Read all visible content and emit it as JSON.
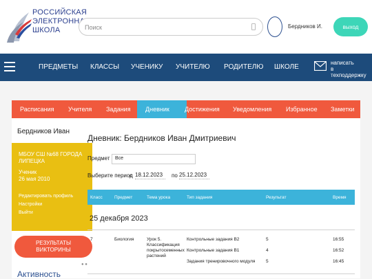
{
  "header": {
    "logo_lines": [
      "РОССИЙСКАЯ",
      "ЭЛЕКТРОННАЯ",
      "ШКОЛА"
    ],
    "search_placeholder": "Поиск",
    "user_name": "Бердников И.",
    "logout_label": "выход"
  },
  "nav": {
    "items": [
      "ПРЕДМЕТЫ",
      "КЛАССЫ",
      "УЧЕНИКУ",
      "УЧИТЕЛЮ",
      "РОДИТЕЛЮ",
      "ШКОЛЕ"
    ],
    "support_lines": [
      "написать",
      "в техподдержку"
    ]
  },
  "tabs": [
    "Расписания",
    "Учителя",
    "Задания",
    "Дневник",
    "Достижения",
    "Уведомления",
    "Избранное",
    "Заметки"
  ],
  "active_tab": "Дневник",
  "sidebar": {
    "name": "Бердников Иван",
    "school_lines": [
      "МБОУ СШ №68 ГОРОДА",
      "ЛИПЕЦКА"
    ],
    "role": "Ученик",
    "dob": "26 мая 2010",
    "links": [
      "Редактировать профиль",
      "Настройки",
      "Выйти"
    ],
    "quiz_lines": [
      "РЕЗУЛЬТАТЫ",
      "ВИКТОРИНЫ"
    ],
    "activity_label": "Активность"
  },
  "diary": {
    "title": "Дневник: Бердников Иван Дмитриевич",
    "subject_label": "Предмет",
    "subject_value": "Все",
    "period_label": "Выберите период",
    "from_label": "с",
    "from_value": "18.12.2023",
    "to_label": "по",
    "to_value": "25.12.2023",
    "columns": [
      "Класс",
      "Предмет",
      "Тема урока",
      "Тип задания",
      "Результат",
      "Время"
    ],
    "date_heading": "25 декабря 2023",
    "row": {
      "class": "7",
      "subject": "Биология",
      "topic_lines": [
        "Урок 5.",
        "Классификация",
        "покрытосеменных",
        "растений"
      ],
      "tasks": [
        {
          "type": "Контрольные задания B2",
          "result": "5",
          "time": "16:55"
        },
        {
          "type": "Контрольные задания B1",
          "result": "4",
          "time": "16:52"
        },
        {
          "type": "Задания тренировочного модуля",
          "result": "5",
          "time": "16:45"
        }
      ]
    }
  },
  "colors": {
    "nav_bg": "#1d4b7b",
    "tab_bg": "#f0593d",
    "accent_blue": "#3cb3da",
    "card_yellow": "#e9bf12",
    "logout_green": "#3dd6b8",
    "logo_blue": "#2b3f8f"
  }
}
